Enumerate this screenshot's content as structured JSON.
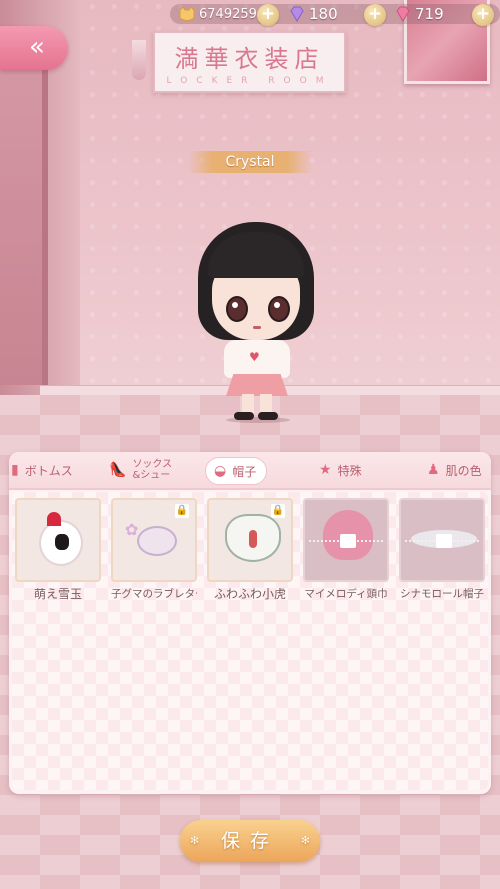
{
  "resources": {
    "coins": "6749259",
    "gems": "180",
    "hearts": "719"
  },
  "header": {
    "shop_title": "満華衣装店",
    "shop_subtitle": "LOCKER ROOM",
    "back_icon": "double-chevron-left-icon"
  },
  "character": {
    "name": "Crystal"
  },
  "tabs": [
    {
      "label": "ボトムス",
      "icon": "skirt-icon"
    },
    {
      "label": "ソックス&シュー",
      "line1": "ソックス",
      "line2": "&シュー",
      "icon": "shoe-icon"
    },
    {
      "label": "帽子",
      "icon": "hat-icon",
      "active": true
    },
    {
      "label": "特殊",
      "icon": "star-icon"
    },
    {
      "label": "肌の色",
      "icon": "figure-icon"
    }
  ],
  "items": [
    {
      "label": "萌え雪玉",
      "locked": false
    },
    {
      "label": "子グマのラブレター",
      "locked": true
    },
    {
      "label": "ふわふわ小虎",
      "locked": true
    },
    {
      "label": "マイメロディ頭巾",
      "locked": true
    },
    {
      "label": "シナモロール帽子",
      "locked": true
    }
  ],
  "save_button": {
    "label": "保存"
  },
  "colors": {
    "accent_pink": "#e5738f",
    "save_orange": "#eca55a",
    "tab_text": "#b8606e"
  }
}
